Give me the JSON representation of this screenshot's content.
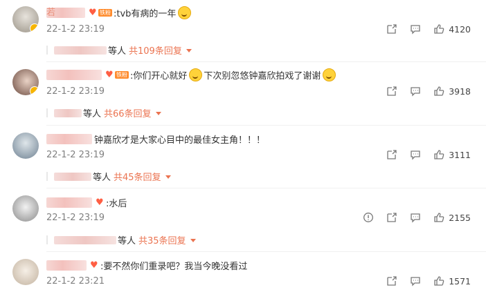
{
  "comments": [
    {
      "name_suffix": "若",
      "text": ":tvb有病的一年",
      "badge_label": "铁粉",
      "date": "22-1-2 23:19",
      "likes": "4120",
      "reply_people": "等人",
      "reply_more": "共109条回复",
      "avatar_colors": [
        "#c9c6bf",
        "#8a8479"
      ]
    },
    {
      "name_suffix": "",
      "text": ":你们开心就好",
      "text2": "下次别忽悠钟嘉欣拍戏了谢谢",
      "badge_label": "铁粉",
      "date": "22-1-2 23:19",
      "likes": "3918",
      "reply_people": "等人",
      "reply_more": "共66条回复",
      "avatar_colors": [
        "#d8c1b5",
        "#5a3a33"
      ]
    },
    {
      "name_suffix": "",
      "text": "钟嘉欣才是大家心目中的最佳女主角！！！",
      "date": "22-1-2 23:19",
      "likes": "3111",
      "reply_people": "等人",
      "reply_more": "共45条回复",
      "avatar_colors": [
        "#bcc7cf",
        "#5f7385"
      ]
    },
    {
      "name_suffix": "",
      "text": ":水后",
      "date": "22-1-2 23:19",
      "likes": "2155",
      "reply_people": "等人",
      "reply_more": "共35条回复",
      "avatar_colors": [
        "#e2e2e2",
        "#7c7c7c"
      ]
    },
    {
      "name_suffix": "",
      "text": ":要不然你们重录吧？我当今晚没看过",
      "date": "22-1-2 23:21",
      "likes": "1571",
      "avatar_colors": [
        "#efe6dc",
        "#c6b8a6"
      ]
    }
  ],
  "icons": {
    "forward": "share-icon",
    "comment": "comment-icon",
    "like": "thumbs-up-icon",
    "report": "report-icon"
  },
  "colors": {
    "accent": "#eb7350",
    "date": "#808080"
  }
}
